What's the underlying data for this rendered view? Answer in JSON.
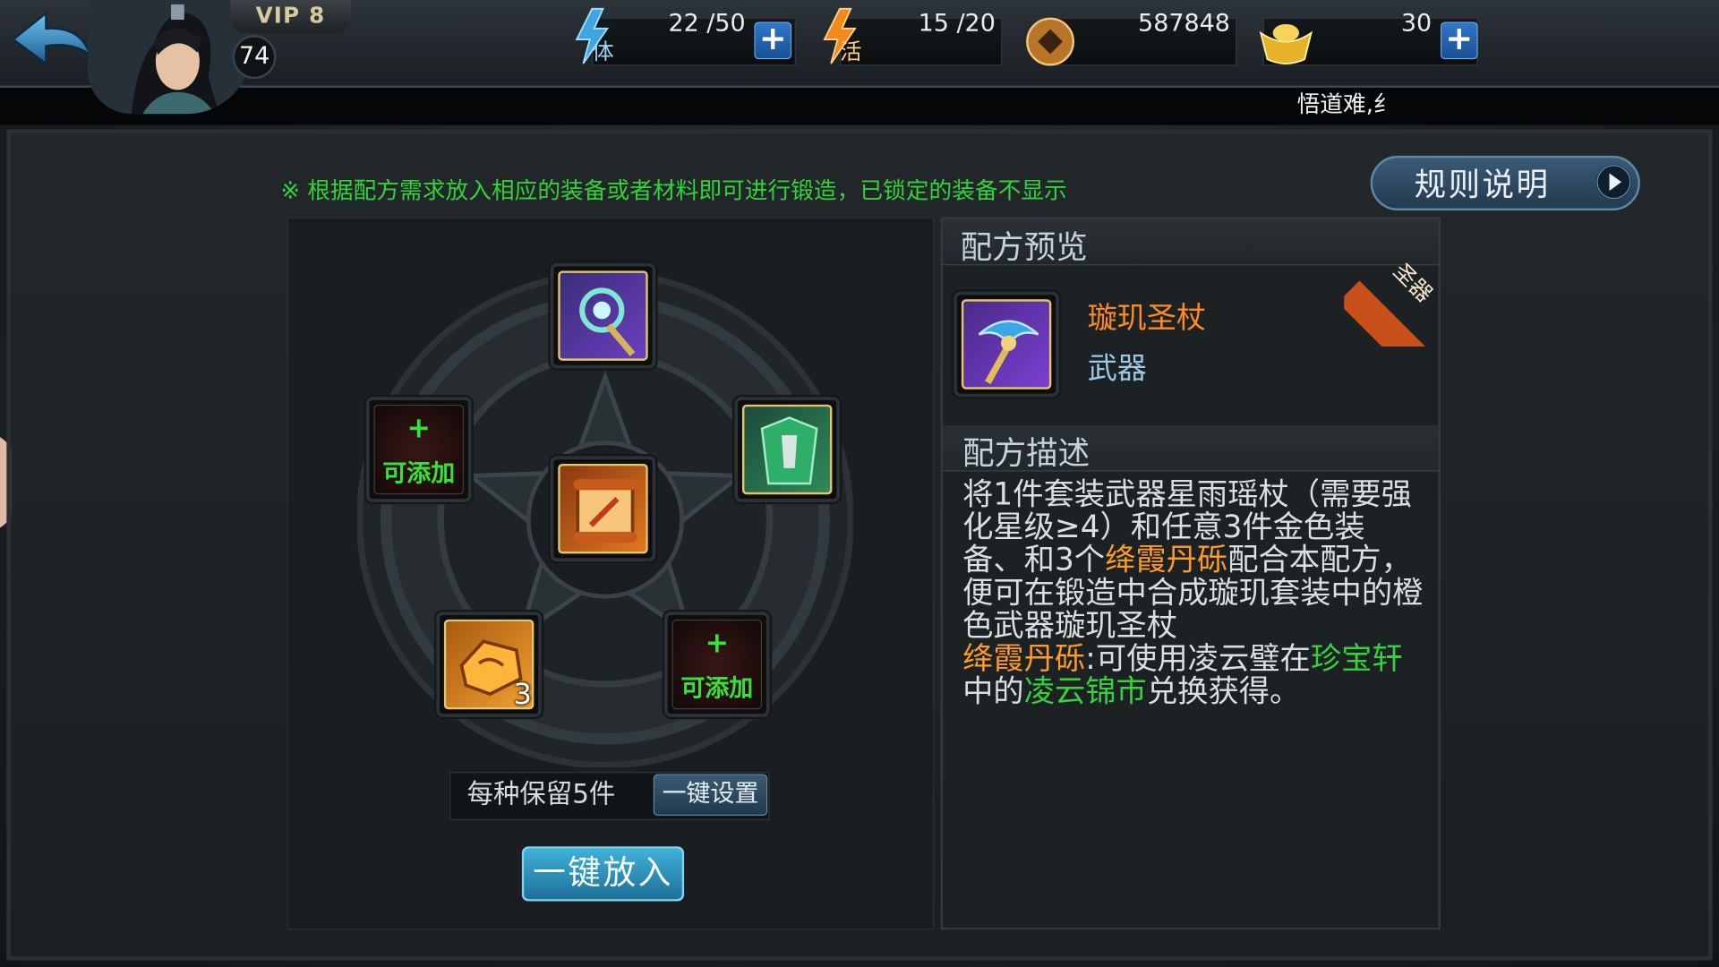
{
  "header": {
    "vip_label": "VIP 8",
    "player_level": "74",
    "stamina": {
      "icon_char": "体",
      "value": "22 /50"
    },
    "vitality": {
      "icon_char": "活",
      "value": "15 /20"
    },
    "copper": {
      "value": "587848"
    },
    "gold": {
      "value": "30"
    }
  },
  "ticker": {
    "text": "悟道难,纟"
  },
  "hint": "※ 根据配方需求放入相应的装备或者材料即可进行锻造，已锁定的装备不显示",
  "rules_button": {
    "label": "规则说明"
  },
  "forge": {
    "add_label": "可添加",
    "add_plus": "+",
    "material_count": "3",
    "keep_label": "每种保留5件",
    "set_button": "一键设置",
    "place_button": "一键放入"
  },
  "preview": {
    "title": "配方预览",
    "item_name": "璇玑圣杖",
    "item_type": "武器",
    "ribbon": "圣器"
  },
  "description": {
    "title": "配方描述",
    "line_a": "将1件套装武器星雨瑶杖（需要强化星级≥4）和任意3件金色装备、和3个",
    "material": "绛霞丹砾",
    "line_b": "配合本配方，便可在锻造中合成璇玑套装中的橙色武器璇玑圣杖",
    "material2": "绛霞丹砾",
    "line_c": ":可使用凌云璧在",
    "shop": "珍宝轩",
    "line_d": "中的",
    "market": "凌云锦市",
    "line_e": "兑换获得。"
  },
  "colors": {
    "hint_green": "#32d33a",
    "item_orange": "#ff8a25",
    "accent_blue": "#2f77c9"
  }
}
